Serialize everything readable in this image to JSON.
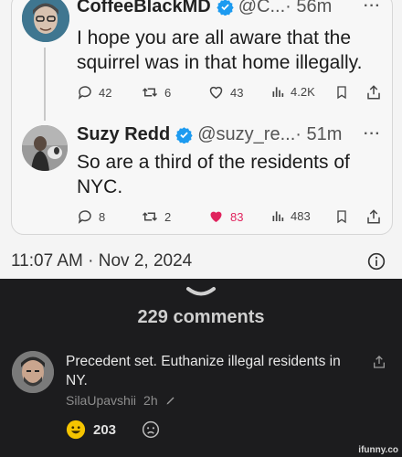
{
  "tweets": [
    {
      "display_name": "CoffeeBlackMD",
      "handle": "@C...",
      "time": "· 56m",
      "more": "···",
      "text": "I hope you are all aware that the squirrel was in that home illegally.",
      "replies": "42",
      "retweets": "6",
      "likes": "43",
      "views": "4.2K"
    },
    {
      "display_name": "Suzy Redd",
      "handle": "@suzy_re...",
      "time": "· 51m",
      "more": "···",
      "text": "So are a third of the residents of NYC.",
      "replies": "8",
      "retweets": "2",
      "likes": "83",
      "views": "483"
    }
  ],
  "timestamp": "11:07 AM · Nov 2, 2024",
  "comments": {
    "count_label": "229 comments",
    "items": [
      {
        "text": "Precedent set. Euthanize illegal residents in NY.",
        "author": "SilaUpavshii",
        "age": "2h",
        "reaction_count": "203"
      }
    ]
  },
  "watermark": "ifunny.co",
  "colors": {
    "verified": "#1d9bf0",
    "like": "#e0245e",
    "dark_bg": "#1c1c1e",
    "reaction_yellow": "#f5c400"
  }
}
